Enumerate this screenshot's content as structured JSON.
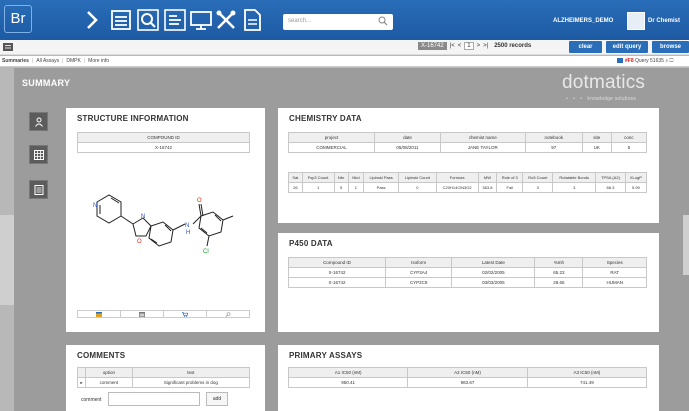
{
  "app": {
    "logo_text": "Br",
    "search_placeholder": "search...",
    "user_group": "ALZHEIMERS_DEMO",
    "user_name": "Dr Chemist"
  },
  "toolbar_icons": [
    "chevron-right-icon",
    "list-icon",
    "search-icon",
    "list-lines-icon",
    "monitor-icon",
    "tools-icon",
    "document-icon"
  ],
  "pager": {
    "query_id": "X-16742",
    "first": "|<",
    "prev": "<",
    "page": "1",
    "next": ">",
    "last": ">|",
    "records": "2500 records"
  },
  "buttons": {
    "clear": "clear",
    "edit_query": "edit query",
    "browse": "browse"
  },
  "tabs": [
    "Summaries",
    "All Assays",
    "DMPK",
    "More info"
  ],
  "query_info": {
    "flag": "#F8",
    "label": "Query 51635",
    "icons": "⌕ ☐"
  },
  "summary_title": "SUMMARY",
  "brand": {
    "name": "dotmatics",
    "dots": "• • •",
    "tagline": "knowledge solutions"
  },
  "side_buttons": [
    "person-icon",
    "grid-icon",
    "form-icon"
  ],
  "structure": {
    "title": "STRUCTURE INFORMATION",
    "compound_header": "COMPOUND ID",
    "compound_id": "X-16742",
    "atom_labels": [
      "N",
      "O",
      "N",
      "N",
      "O",
      "Cl",
      "H"
    ]
  },
  "chemistry": {
    "title": "CHEMISTRY DATA",
    "headers": [
      "project",
      "date",
      "chemist name",
      "notebook",
      "site",
      "conc"
    ],
    "row": [
      "COMMERCIAL",
      "05/08/2011",
      "JANE TAYLOR",
      "97",
      "UK",
      "5"
    ],
    "prop_headers": [
      "Sat",
      "Fsp3 Count",
      "Nbr",
      "Nbd",
      "Lipinski Pass",
      "Lipinski Count",
      "Formula",
      "MW",
      "Rule of 3",
      "Ro5 Count",
      "Rotatable Bonds",
      "TPSA (A2)",
      "XLogP"
    ],
    "prop_row": [
      "26",
      "1",
      "5",
      "1",
      "Pass",
      "0",
      "C20H14ClN3O2",
      "363.8",
      "Fail",
      "3",
      "3",
      "68.3",
      "5.99"
    ]
  },
  "p450": {
    "title": "P450 DATA",
    "headers": [
      "Compound ID",
      "Isoform",
      "Latest Date",
      "%Inh",
      "Species"
    ],
    "rows": [
      [
        "X-16742",
        "CYP3A4",
        "02/02/2005",
        "65.23",
        "RAT"
      ],
      [
        "X-16742",
        "CYP2C9",
        "03/03/2005",
        "28.65",
        "HUMAN"
      ]
    ]
  },
  "comments": {
    "title": "COMMENTS",
    "headers": [
      "",
      "option",
      "text"
    ],
    "rows": [
      [
        "▸",
        "comment",
        "Significant problems in dog"
      ]
    ],
    "input_label": "comment",
    "add_label": "add"
  },
  "primary": {
    "title": "PRIMARY ASSAYS",
    "headers": [
      "A1 IC50 (nM)",
      "A2 IC50 (nM)",
      "A3 IC50 (nM)"
    ],
    "row": [
      "950.41",
      "983.67",
      "741.49"
    ]
  }
}
